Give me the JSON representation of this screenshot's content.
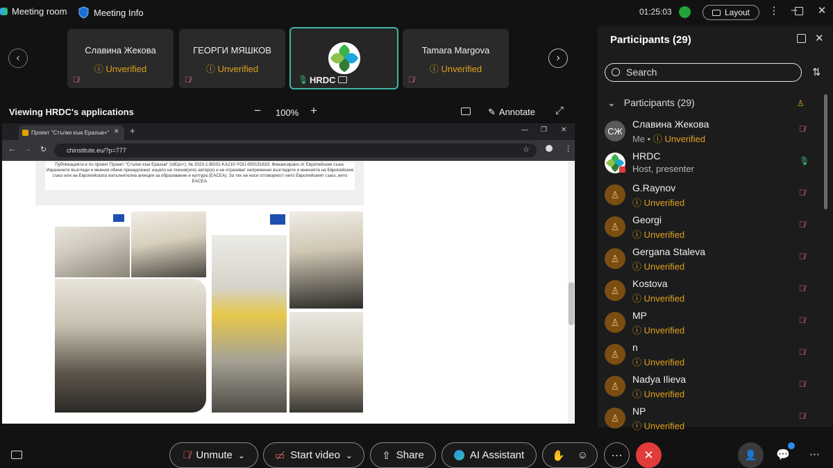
{
  "topbar": {
    "meeting_room": "Meeting room",
    "meeting_info": "Meeting Info",
    "timer": "01:25:03",
    "layout": "Layout"
  },
  "strip": {
    "tiles": [
      {
        "name": "Славина Жекова",
        "status": "Unverified"
      },
      {
        "name": "ГЕОРГИ МЯШКОВ",
        "status": "Unverified"
      },
      {
        "name": "HRDC"
      },
      {
        "name": "Tamara Margova",
        "status": "Unverified"
      }
    ]
  },
  "viewbar": {
    "title": "Viewing HRDC's applications",
    "zoom": "100%",
    "annotate": "Annotate"
  },
  "browser": {
    "tab": "Проект \"Стъпки към Еразъм+\"",
    "url": "chinstitute.eu/?p=777",
    "doc_text": "Публикацията е по проект Проект \"Стъпки към Еразъм\" (stEps+), № 2023-1-BG01-KA210-YOU-000151633. Финансирано от Европейския съюз. Изразените възгледи и мнения обаче принадлежат изцяло на техния(ите) автор(и) и не отразяват непременно възгледите и мненията на Европейския съюз или на Европейската изпълнителна агенция за образование и култура (EACEA). За тях не носи отговорност нито Европейският съюз, нито EACEA."
  },
  "panel": {
    "title": "Participants (29)",
    "search_placeholder": "Search",
    "section": "Participants (29)",
    "participants": [
      {
        "initials": "СЖ",
        "name": "Славина Жекова",
        "sub_me": "Me •",
        "sub": "Unverified"
      },
      {
        "initials": "",
        "name": "HRDC",
        "sub": "Host, presenter"
      },
      {
        "initials": "",
        "name": "G.Raynov",
        "sub": "Unverified"
      },
      {
        "initials": "",
        "name": "Georgi",
        "sub": "Unverified"
      },
      {
        "initials": "",
        "name": "Gergana Staleva",
        "sub": "Unverified"
      },
      {
        "initials": "",
        "name": "Kostova",
        "sub": "Unverified"
      },
      {
        "initials": "",
        "name": "MP",
        "sub": "Unverified"
      },
      {
        "initials": "",
        "name": "n",
        "sub": "Unverified"
      },
      {
        "initials": "",
        "name": "Nadya Ilieva",
        "sub": "Unverified"
      },
      {
        "initials": "",
        "name": "NP",
        "sub": "Unverified"
      }
    ]
  },
  "bottombar": {
    "unmute": "Unmute",
    "start_video": "Start video",
    "share": "Share",
    "ai_assistant": "AI Assistant"
  },
  "colors": {
    "unverified": "#e0a21b",
    "muted_mic": "#e06666",
    "active_tile": "#3fb5a3",
    "end_call": "#e23b3b",
    "avatar_orange": "#7a4e12"
  }
}
